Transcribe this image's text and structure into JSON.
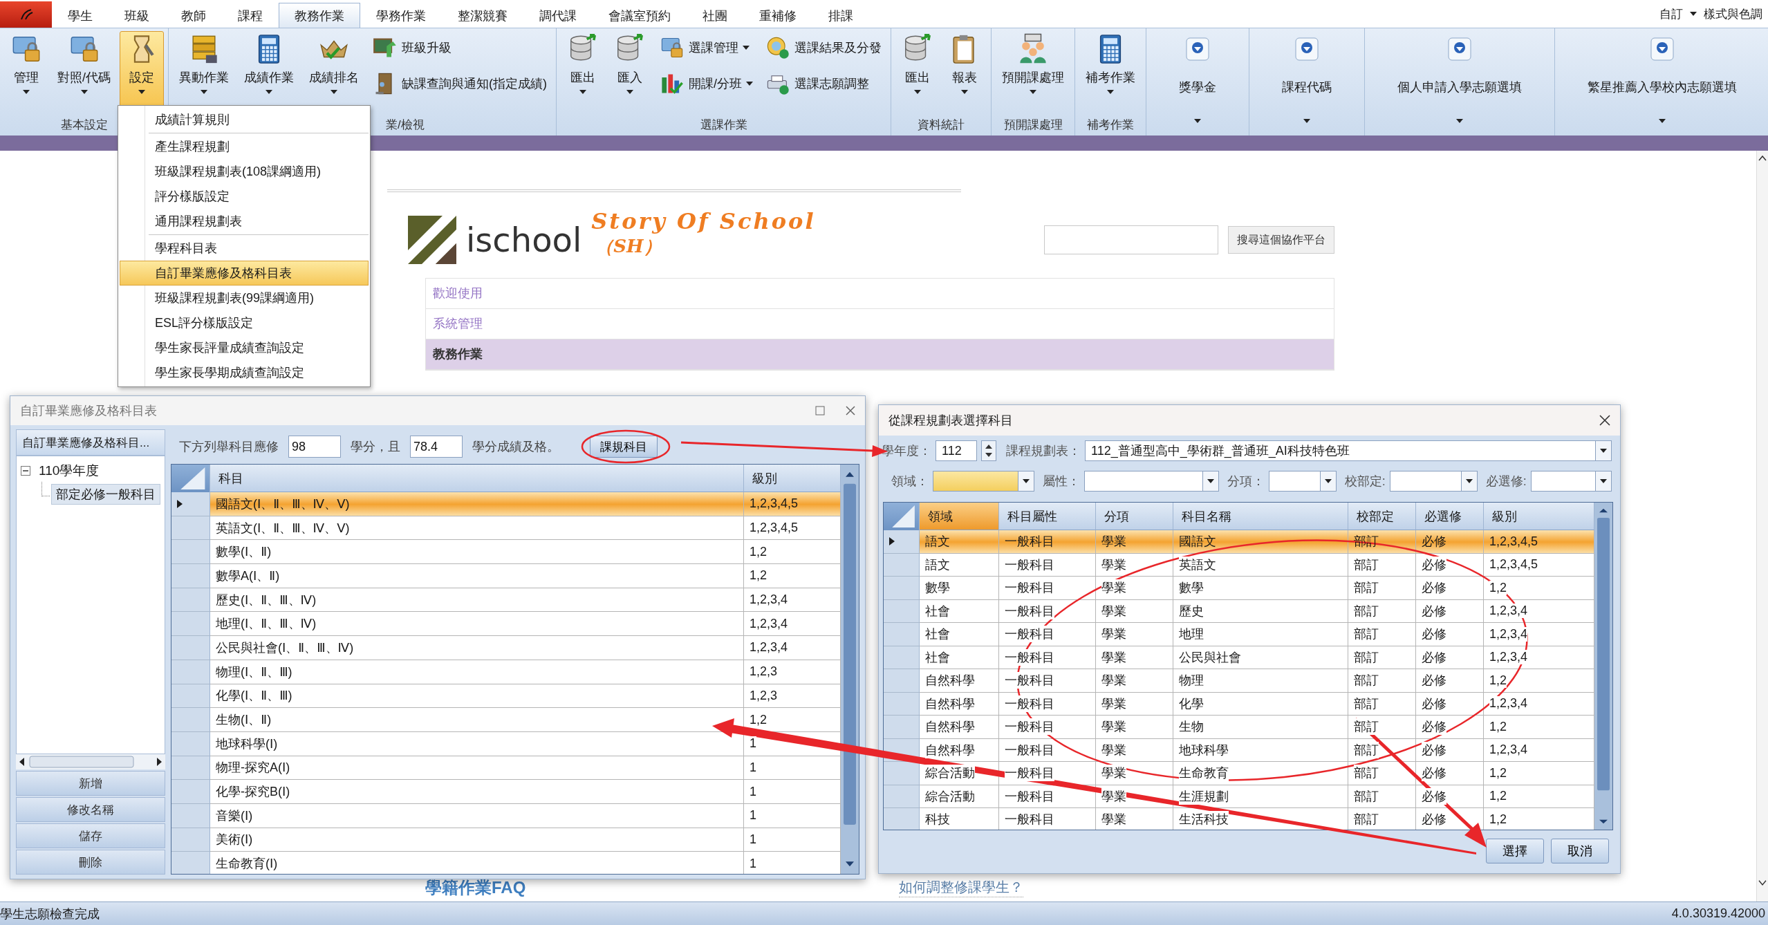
{
  "ribbon": {
    "tabs": [
      {
        "label": "學生",
        "selected": false
      },
      {
        "label": "班級",
        "selected": false
      },
      {
        "label": "教師",
        "selected": false
      },
      {
        "label": "課程",
        "selected": false
      },
      {
        "label": "教務作業",
        "selected": true
      },
      {
        "label": "學務作業",
        "selected": false
      },
      {
        "label": "整潔競賽",
        "selected": false
      },
      {
        "label": "調代課",
        "selected": false
      },
      {
        "label": "會議室預約",
        "selected": false
      },
      {
        "label": "社團",
        "selected": false
      },
      {
        "label": "重補修",
        "selected": false
      },
      {
        "label": "排課",
        "selected": false
      }
    ],
    "quick_access": {
      "customize": "自訂",
      "theme": "樣式與色調"
    },
    "groups": [
      {
        "label": "基本設定",
        "buttons": [
          {
            "label": "管理",
            "kind": "large",
            "dropdown": true,
            "pressed": false
          },
          {
            "label": "對照/代碼",
            "kind": "large",
            "dropdown": true,
            "pressed": false
          },
          {
            "label": "設定",
            "kind": "large",
            "dropdown": true,
            "pressed": true
          }
        ]
      },
      {
        "label": "業/檢視",
        "buttons": [
          {
            "label": "異動作業",
            "kind": "large",
            "dropdown": true,
            "pressed": false
          },
          {
            "label": "成績作業",
            "kind": "large",
            "dropdown": true,
            "pressed": false
          },
          {
            "label": "成績排名",
            "kind": "large",
            "dropdown": true,
            "pressed": false
          },
          {
            "label": "班級升級",
            "kind": "small",
            "dropdown": false,
            "pressed": false
          },
          {
            "label": "缺課查詢與通知(指定成績)",
            "kind": "small",
            "dropdown": false,
            "pressed": false
          }
        ]
      },
      {
        "label": "選課作業",
        "buttons": [
          {
            "label": "匯出",
            "kind": "large",
            "dropdown": true,
            "pressed": false
          },
          {
            "label": "匯入",
            "kind": "large",
            "dropdown": true,
            "pressed": false
          },
          {
            "label": "選課管理",
            "kind": "small",
            "dropdown": true,
            "pressed": false
          },
          {
            "label": "開課/分班",
            "kind": "small",
            "dropdown": true,
            "pressed": false
          },
          {
            "label": "選課結果及分發",
            "kind": "small",
            "dropdown": false,
            "pressed": false
          },
          {
            "label": "選課志願調整",
            "kind": "small",
            "dropdown": false,
            "pressed": false
          }
        ]
      },
      {
        "label": "資料統計",
        "buttons": [
          {
            "label": "匯出",
            "kind": "large",
            "dropdown": true,
            "pressed": false
          },
          {
            "label": "報表",
            "kind": "large",
            "dropdown": true,
            "pressed": false
          }
        ]
      },
      {
        "label": "預開課處理",
        "buttons": [
          {
            "label": "預開課處理",
            "kind": "large",
            "dropdown": true,
            "pressed": false
          }
        ]
      },
      {
        "label": "補考作業",
        "buttons": [
          {
            "label": "補考作業",
            "kind": "large",
            "dropdown": true,
            "pressed": false
          }
        ]
      },
      {
        "buttons": [
          {
            "label": "獎學金",
            "kind": "round",
            "dropdown": true,
            "pressed": false
          }
        ]
      },
      {
        "buttons": [
          {
            "label": "課程代碼",
            "kind": "round",
            "dropdown": true,
            "pressed": false
          }
        ]
      },
      {
        "buttons": [
          {
            "label": "個人申請入學志願選填",
            "kind": "round",
            "dropdown": true,
            "pressed": false
          }
        ]
      },
      {
        "buttons": [
          {
            "label": "繁星推薦入學校內志願選填",
            "kind": "round",
            "dropdown": true,
            "pressed": false
          }
        ]
      }
    ]
  },
  "settings_menu": {
    "sections": [
      [
        {
          "label": "成績計算規則",
          "selected": false
        }
      ],
      [
        {
          "label": "產生課程規劃",
          "selected": false
        },
        {
          "label": "班級課程規劃表(108課綱適用)",
          "selected": false
        },
        {
          "label": "評分樣版設定",
          "selected": false
        },
        {
          "label": "通用課程規劃表",
          "selected": false
        }
      ],
      [
        {
          "label": "學程科目表",
          "selected": false
        },
        {
          "label": "自訂畢業應修及格科目表",
          "selected": true
        },
        {
          "label": "班級課程規劃表(99課綱適用)",
          "selected": false
        },
        {
          "label": "ESL評分樣版設定",
          "selected": false
        },
        {
          "label": "學生家長評量成績查詢設定",
          "selected": false
        },
        {
          "label": "學生家長學期成績查詢設定",
          "selected": false
        }
      ]
    ]
  },
  "site": {
    "brand": "ischool",
    "title": "Story Of School",
    "subtitle": "（SH）",
    "search_button": "搜尋這個協作平台",
    "nav": [
      {
        "label": "歡迎使用",
        "selected": false
      },
      {
        "label": "系統管理",
        "selected": false
      },
      {
        "label": "教務作業",
        "selected": true
      }
    ],
    "links": [
      "學籍作業FAQ",
      "如何調整修課學生？"
    ]
  },
  "graduation_dialog": {
    "title": "自訂畢業應修及格科目表",
    "tree_header": "自訂畢業應修及格科目...",
    "tree": [
      {
        "label": "110學年度",
        "expanded": true,
        "selected": false,
        "children": [
          {
            "label": "部定必修一般科目",
            "selected": true
          }
        ]
      }
    ],
    "buttons": [
      "新增",
      "修改名稱",
      "儲存",
      "刪除"
    ],
    "rule": {
      "prefix": "下方列舉科目應修",
      "credits": "98",
      "middle": "學分，且",
      "score": "78.4",
      "suffix": "學分成績及格。"
    },
    "action_button": "課規科目",
    "table": {
      "columns": [
        "科目",
        "級別"
      ],
      "rows": [
        {
          "cells": [
            "國語文(Ⅰ、Ⅱ、Ⅲ、Ⅳ、Ⅴ)",
            "1,2,3,4,5"
          ],
          "selected": true
        },
        {
          "cells": [
            "英語文(Ⅰ、Ⅱ、Ⅲ、Ⅳ、Ⅴ)",
            "1,2,3,4,5"
          ],
          "selected": false
        },
        {
          "cells": [
            "數學(Ⅰ、Ⅱ)",
            "1,2"
          ],
          "selected": false
        },
        {
          "cells": [
            "數學A(Ⅰ、Ⅱ)",
            "1,2"
          ],
          "selected": false
        },
        {
          "cells": [
            "歷史(Ⅰ、Ⅱ、Ⅲ、Ⅳ)",
            "1,2,3,4"
          ],
          "selected": false
        },
        {
          "cells": [
            "地理(Ⅰ、Ⅱ、Ⅲ、Ⅳ)",
            "1,2,3,4"
          ],
          "selected": false
        },
        {
          "cells": [
            "公民與社會(Ⅰ、Ⅱ、Ⅲ、Ⅳ)",
            "1,2,3,4"
          ],
          "selected": false
        },
        {
          "cells": [
            "物理(Ⅰ、Ⅱ、Ⅲ)",
            "1,2,3"
          ],
          "selected": false
        },
        {
          "cells": [
            "化學(Ⅰ、Ⅱ、Ⅲ)",
            "1,2,3"
          ],
          "selected": false
        },
        {
          "cells": [
            "生物(Ⅰ、Ⅱ)",
            "1,2"
          ],
          "selected": false
        },
        {
          "cells": [
            "地球科學(Ⅰ)",
            "1"
          ],
          "selected": false
        },
        {
          "cells": [
            "物理-探究A(Ⅰ)",
            "1"
          ],
          "selected": false
        },
        {
          "cells": [
            "化學-探究B(Ⅰ)",
            "1"
          ],
          "selected": false
        },
        {
          "cells": [
            "音樂(Ⅰ)",
            "1"
          ],
          "selected": false
        },
        {
          "cells": [
            "美術(Ⅰ)",
            "1"
          ],
          "selected": false
        },
        {
          "cells": [
            "生命教育(Ⅰ)",
            "1"
          ],
          "selected": false
        }
      ]
    }
  },
  "subject_picker_dialog": {
    "title": "從課程規劃表選擇科目",
    "year_label": "學年度：",
    "year": "112",
    "plan_label": "課程規劃表：",
    "plan": "112_普通型高中_學術群_普通班_AI科技特色班",
    "filters": [
      {
        "label": "領域：",
        "focused": true
      },
      {
        "label": "屬性：",
        "focused": false
      },
      {
        "label": "分項：",
        "focused": false
      },
      {
        "label": "校部定:",
        "focused": false
      },
      {
        "label": "必選修:",
        "focused": false
      }
    ],
    "table": {
      "columns": [
        {
          "label": "領域",
          "highlighted": true
        },
        {
          "label": "科目屬性",
          "highlighted": false
        },
        {
          "label": "分項",
          "highlighted": false
        },
        {
          "label": "科目名稱",
          "highlighted": false
        },
        {
          "label": "校部定",
          "highlighted": false
        },
        {
          "label": "必選修",
          "highlighted": false
        },
        {
          "label": "級別",
          "highlighted": false
        }
      ],
      "rows": [
        {
          "cells": [
            "語文",
            "一般科目",
            "學業",
            "國語文",
            "部訂",
            "必修",
            "1,2,3,4,5"
          ],
          "selected": true
        },
        {
          "cells": [
            "語文",
            "一般科目",
            "學業",
            "英語文",
            "部訂",
            "必修",
            "1,2,3,4,5"
          ],
          "selected": false
        },
        {
          "cells": [
            "數學",
            "一般科目",
            "學業",
            "數學",
            "部訂",
            "必修",
            "1,2"
          ],
          "selected": false
        },
        {
          "cells": [
            "社會",
            "一般科目",
            "學業",
            "歷史",
            "部訂",
            "必修",
            "1,2,3,4"
          ],
          "selected": false
        },
        {
          "cells": [
            "社會",
            "一般科目",
            "學業",
            "地理",
            "部訂",
            "必修",
            "1,2,3,4"
          ],
          "selected": false
        },
        {
          "cells": [
            "社會",
            "一般科目",
            "學業",
            "公民與社會",
            "部訂",
            "必修",
            "1,2,3,4"
          ],
          "selected": false
        },
        {
          "cells": [
            "自然科學",
            "一般科目",
            "學業",
            "物理",
            "部訂",
            "必修",
            "1,2"
          ],
          "selected": false
        },
        {
          "cells": [
            "自然科學",
            "一般科目",
            "學業",
            "化學",
            "部訂",
            "必修",
            "1,2,3,4"
          ],
          "selected": false
        },
        {
          "cells": [
            "自然科學",
            "一般科目",
            "學業",
            "生物",
            "部訂",
            "必修",
            "1,2"
          ],
          "selected": false
        },
        {
          "cells": [
            "自然科學",
            "一般科目",
            "學業",
            "地球科學",
            "部訂",
            "必修",
            "1,2,3,4"
          ],
          "selected": false
        },
        {
          "cells": [
            "綜合活動",
            "一般科目",
            "學業",
            "生命教育",
            "部訂",
            "必修",
            "1,2"
          ],
          "selected": false
        },
        {
          "cells": [
            "綜合活動",
            "一般科目",
            "學業",
            "生涯規劃",
            "部訂",
            "必修",
            "1,2"
          ],
          "selected": false
        },
        {
          "cells": [
            "科技",
            "一般科目",
            "學業",
            "生活科技",
            "部訂",
            "必修",
            "1,2"
          ],
          "selected": false
        }
      ]
    },
    "buttons": [
      "選擇",
      "取消"
    ]
  },
  "status_bar": {
    "message": "學生志願檢查完成",
    "version": "4.0.30319.42000"
  }
}
